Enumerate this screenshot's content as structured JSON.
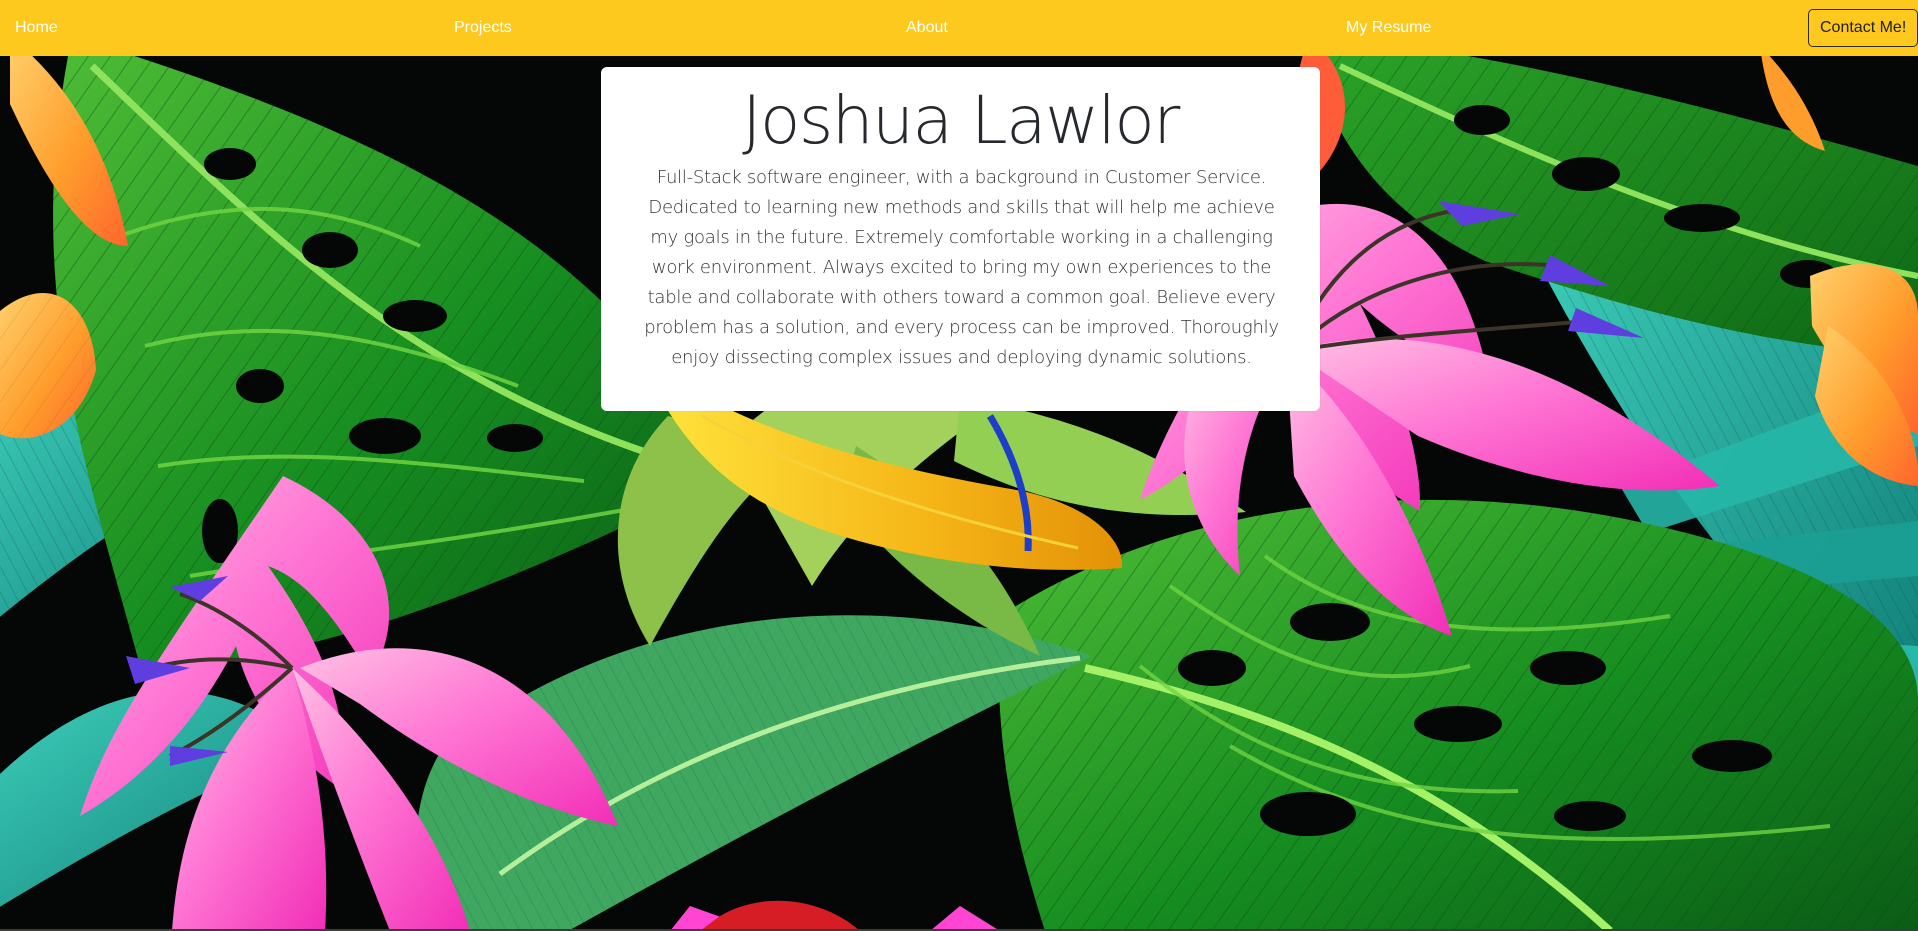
{
  "nav": {
    "items": [
      {
        "label": "Home"
      },
      {
        "label": "Projects"
      },
      {
        "label": "About"
      },
      {
        "label": "My Resume"
      }
    ],
    "contact_label": "Contact Me!"
  },
  "hero": {
    "name": "Joshua Lawlor",
    "bio": "Full-Stack software engineer, with a background in Customer Service. Dedicated to learning new methods and skills that will help me achieve my goals in the future. Extremely comfortable working in a challenging work environment. Always excited to bring my own experiences to the table and collaborate with others toward a common goal. Believe every problem has a solution, and every process can be improved. Thoroughly enjoy dissecting complex issues and deploying dynamic solutions."
  },
  "colors": {
    "nav_background": "#fec91f",
    "nav_text": "#ffffff",
    "card_background": "#ffffff",
    "page_background": "#050706"
  }
}
